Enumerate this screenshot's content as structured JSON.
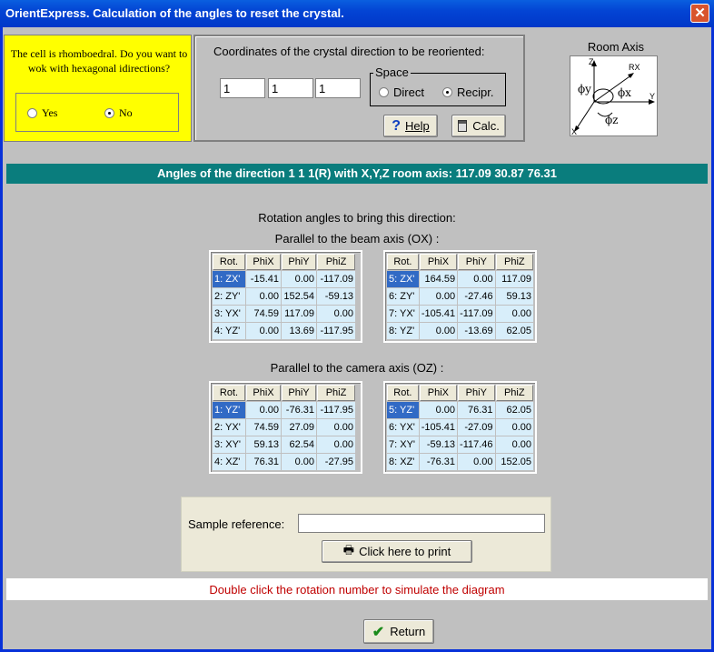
{
  "window": {
    "title": "OrientExpress. Calculation of the angles to reset the crystal.",
    "close": "✕"
  },
  "cell_question": {
    "text": "The cell is rhomboedral. Do you want to wok with hexagonal idirections?",
    "yes_label": "Yes",
    "no_label": "No",
    "selected": "No"
  },
  "coords": {
    "label": "Coordinates of the crystal direction  to be reoriented:",
    "values": [
      "1",
      "1",
      "1"
    ],
    "space_legend": "Space",
    "direct_label": "Direct",
    "recipr_label": "Recipr.",
    "selected_space": "Recipr.",
    "help_label": "Help",
    "calc_label": "Calc."
  },
  "room_axis": {
    "title": "Room Axis",
    "labels": {
      "z": "Z",
      "y": "Y",
      "x": "X",
      "rx": "RX",
      "phiy": "ϕy",
      "phix": "ϕx",
      "phiz": "ϕz"
    }
  },
  "header": "Angles of the direction 1 1 1(R) with X,Y,Z room axis:  117.09  30.87  76.31",
  "rotation_title": "Rotation angles to bring this direction:",
  "beam_title": "Parallel to the beam axis (OX) :",
  "camera_title": "Parallel to the camera axis (OZ) :",
  "columns": [
    "Rot.",
    "PhiX",
    "PhiY",
    "PhiZ"
  ],
  "beam_left": [
    [
      "1: ZX'",
      "-15.41",
      "0.00",
      "-117.09"
    ],
    [
      "2: ZY'",
      "0.00",
      "152.54",
      "-59.13"
    ],
    [
      "3: YX'",
      "74.59",
      "117.09",
      "0.00"
    ],
    [
      "4: YZ'",
      "0.00",
      "13.69",
      "-117.95"
    ]
  ],
  "beam_right": [
    [
      "5: ZX'",
      "164.59",
      "0.00",
      "117.09"
    ],
    [
      "6: ZY'",
      "0.00",
      "-27.46",
      "59.13"
    ],
    [
      "7: YX'",
      "-105.41",
      "-117.09",
      "0.00"
    ],
    [
      "8: YZ'",
      "0.00",
      "-13.69",
      "62.05"
    ]
  ],
  "camera_left": [
    [
      "1: YZ'",
      "0.00",
      "-76.31",
      "-117.95"
    ],
    [
      "2: YX'",
      "74.59",
      "27.09",
      "0.00"
    ],
    [
      "3: XY'",
      "59.13",
      "62.54",
      "0.00"
    ],
    [
      "4: XZ'",
      "76.31",
      "0.00",
      "-27.95"
    ]
  ],
  "camera_right": [
    [
      "5: YZ'",
      "0.00",
      "76.31",
      "62.05"
    ],
    [
      "6: YX'",
      "-105.41",
      "-27.09",
      "0.00"
    ],
    [
      "7: XY'",
      "-59.13",
      "-117.46",
      "0.00"
    ],
    [
      "8: XZ'",
      "-76.31",
      "0.00",
      "152.05"
    ]
  ],
  "sample": {
    "label": "Sample reference:",
    "value": "",
    "print_label": "Click here to print"
  },
  "hint": "Double click the rotation number to simulate the  diagram",
  "return_label": "Return"
}
